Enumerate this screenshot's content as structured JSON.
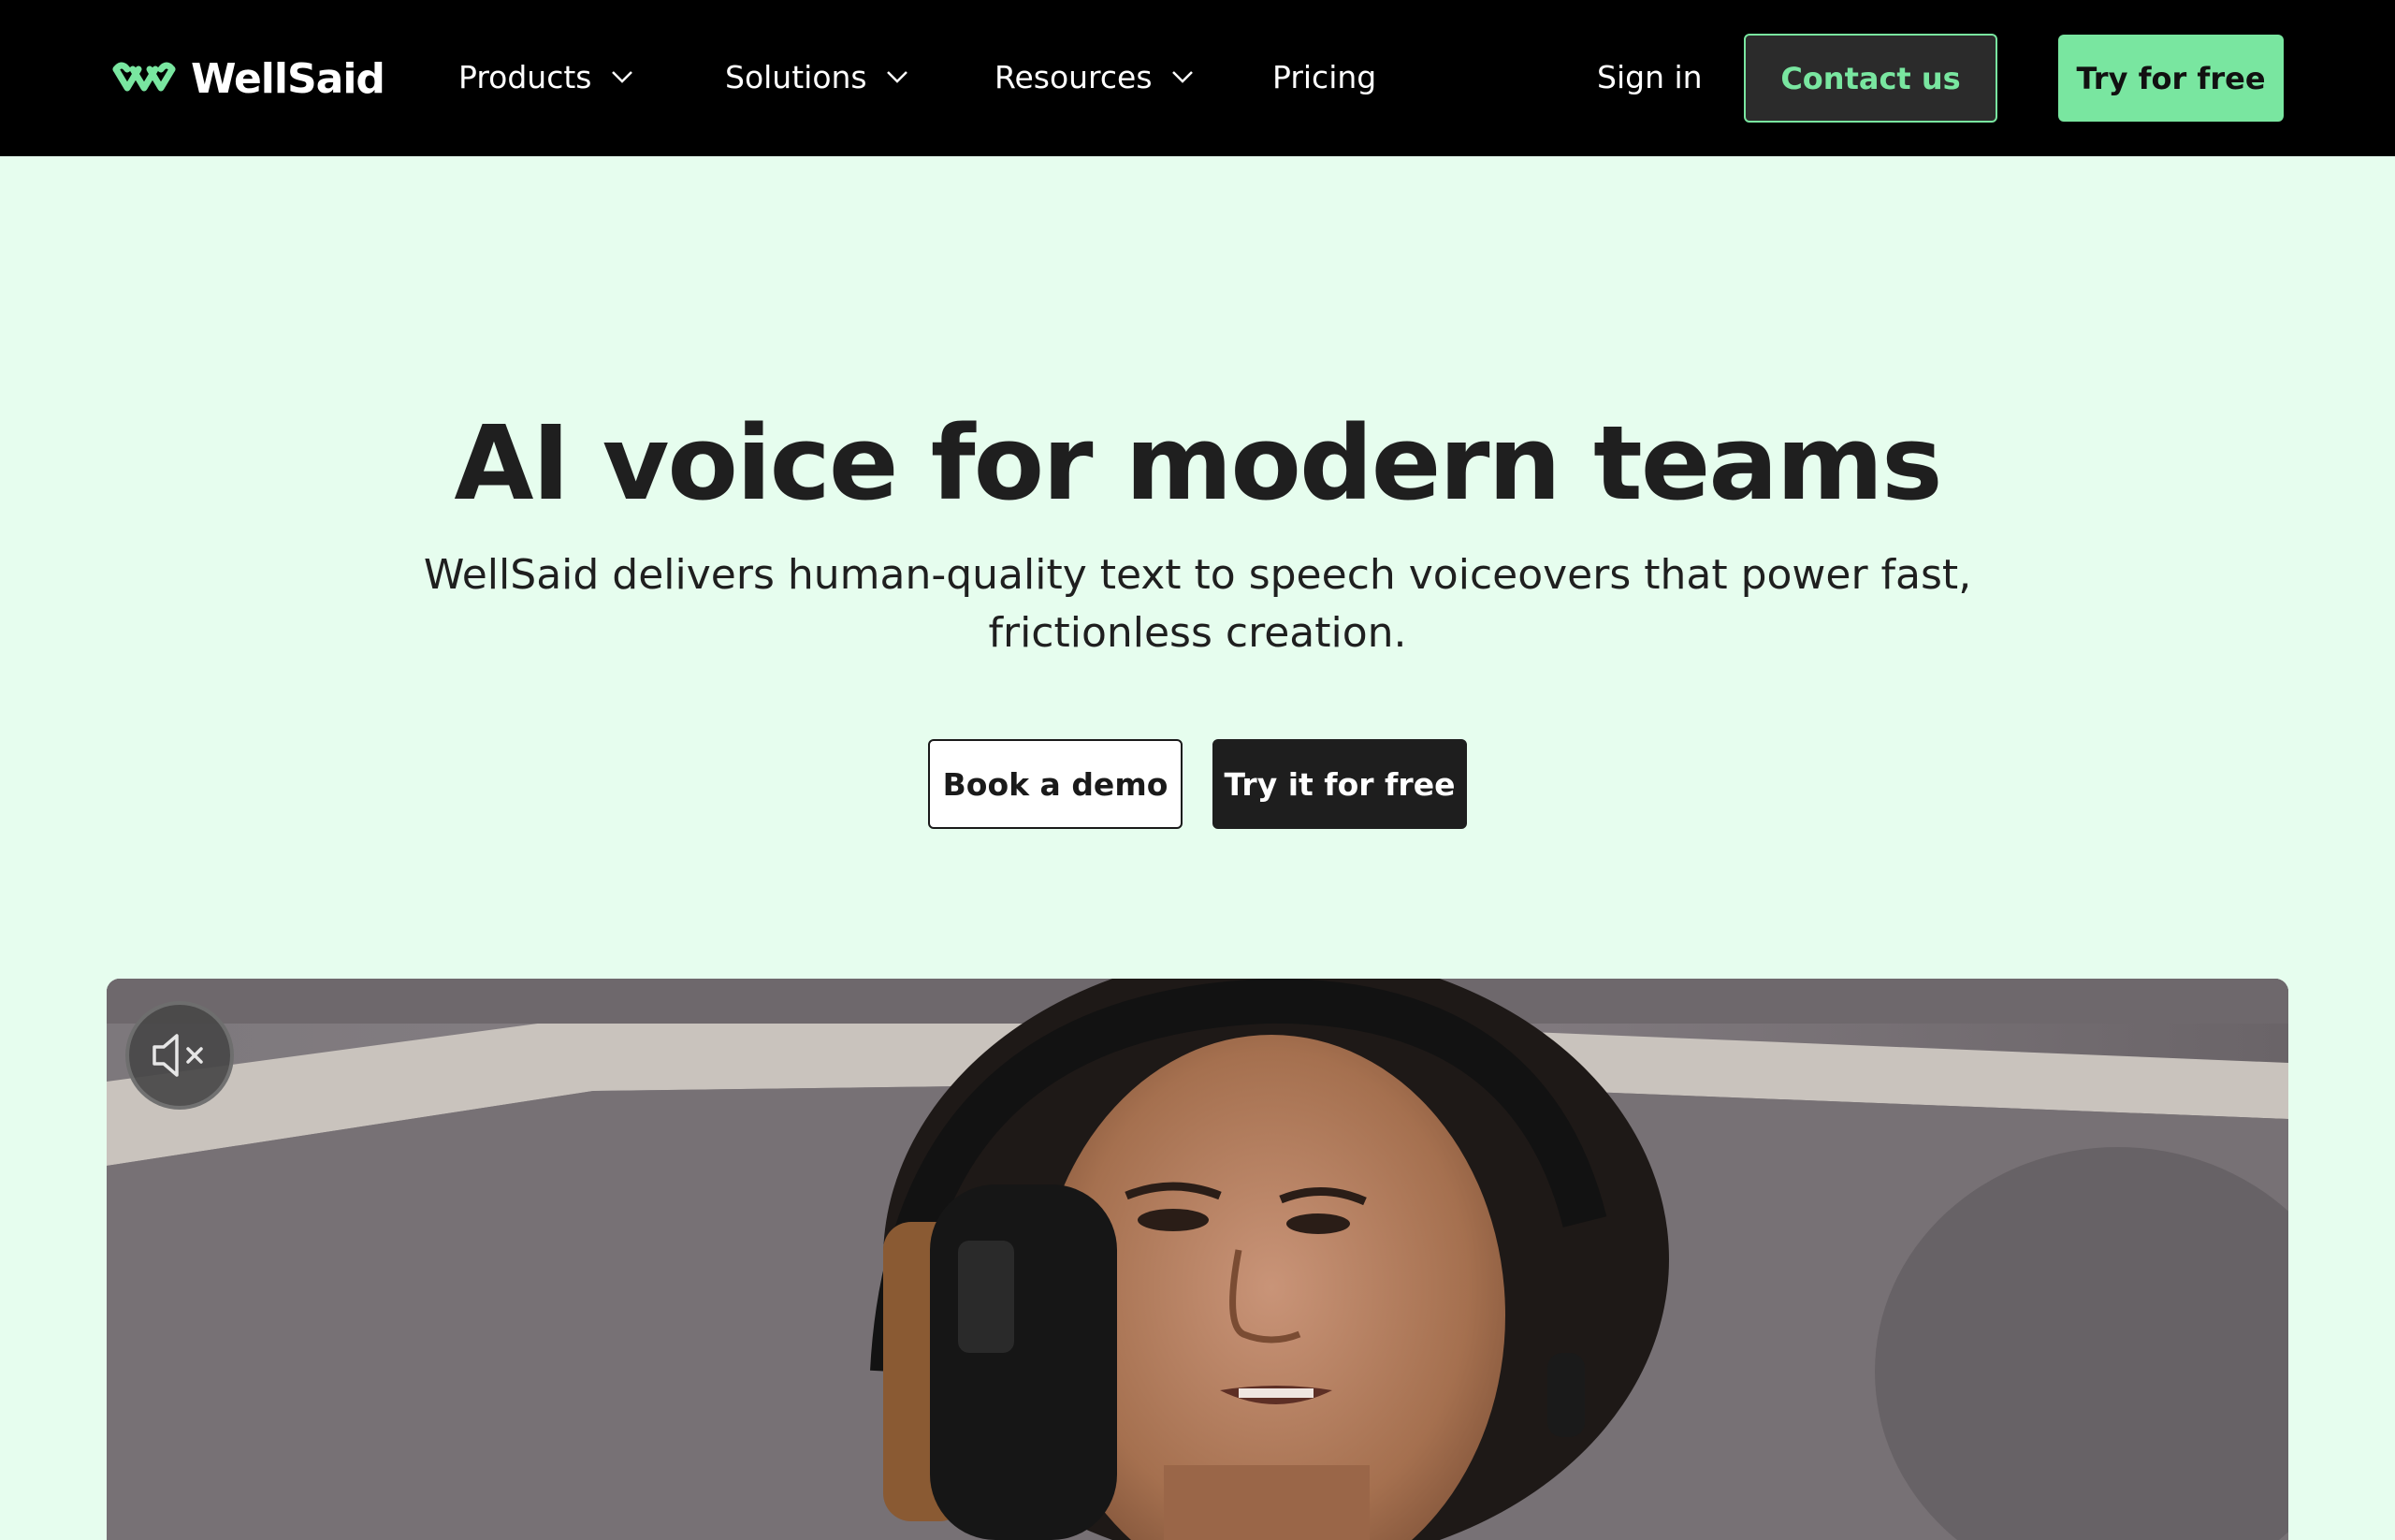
{
  "brand": {
    "name": "WellSaid",
    "logo_icon": "wellsaid-logo-icon",
    "accent_color": "#79e6a0",
    "background_color": "#e6fdee",
    "nav_background": "#000000"
  },
  "nav": {
    "items": [
      {
        "label": "Products",
        "has_dropdown": true
      },
      {
        "label": "Solutions",
        "has_dropdown": true
      },
      {
        "label": "Resources",
        "has_dropdown": true
      },
      {
        "label": "Pricing",
        "has_dropdown": false
      }
    ],
    "sign_in": "Sign in",
    "contact": "Contact us",
    "try_free": "Try for free"
  },
  "hero": {
    "title": "AI voice for modern teams",
    "subtitle": "WellSaid delivers human-quality text to speech voiceovers that power fast, frictionless creation.",
    "demo_button": "Book a demo",
    "try_button": "Try it for free"
  },
  "video": {
    "mute_icon": "speaker-muted-icon",
    "muted": true
  }
}
